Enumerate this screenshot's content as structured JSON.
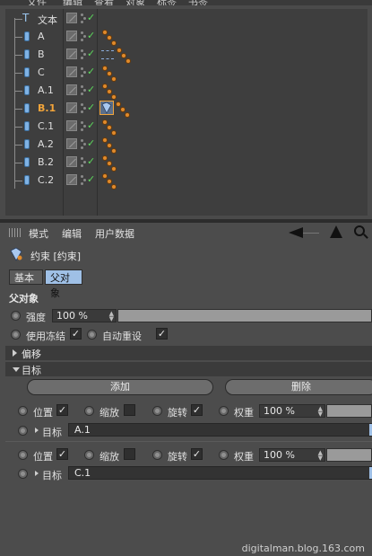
{
  "menubar": {
    "items": [
      "文件",
      "编辑",
      "查看",
      "对象",
      "标签",
      "书签"
    ]
  },
  "object_manager": {
    "rows": [
      {
        "name": "文本",
        "kind": "text",
        "selected": false,
        "tags": "none"
      },
      {
        "name": "A",
        "kind": "null",
        "selected": false,
        "tags": "dots"
      },
      {
        "name": "B",
        "kind": "null",
        "selected": false,
        "tags": "dots-target"
      },
      {
        "name": "C",
        "kind": "null",
        "selected": false,
        "tags": "dots"
      },
      {
        "name": "A.1",
        "kind": "null",
        "selected": false,
        "tags": "dots"
      },
      {
        "name": "B.1",
        "kind": "null",
        "selected": true,
        "tags": "constraint-selected"
      },
      {
        "name": "C.1",
        "kind": "null",
        "selected": false,
        "tags": "dots"
      },
      {
        "name": "A.2",
        "kind": "null",
        "selected": false,
        "tags": "dots"
      },
      {
        "name": "B.2",
        "kind": "null",
        "selected": false,
        "tags": "dots"
      },
      {
        "name": "C.2",
        "kind": "null",
        "selected": false,
        "tags": "dots"
      }
    ]
  },
  "attribute_manager": {
    "menu": {
      "mode": "模式",
      "edit": "编辑",
      "user_data": "用户数据"
    },
    "title": "约束 [约束]",
    "tabs": {
      "basic": "基本",
      "parent": "父对象"
    },
    "section_parent": "父对象",
    "strength": {
      "label": "强度",
      "value": "100 %",
      "level": 1.0
    },
    "use_freeze": {
      "label": "使用冻结",
      "checked": true
    },
    "auto_reset": {
      "label": "自动重设",
      "checked": true
    },
    "offset_header": "偏移",
    "targets_header": "目标",
    "add_button": "添加",
    "delete_button": "删除",
    "targets": [
      {
        "position": {
          "label": "位置",
          "checked": true
        },
        "scale": {
          "label": "缩放",
          "checked": false
        },
        "rotation": {
          "label": "旋转",
          "checked": true
        },
        "weight": {
          "label": "权重",
          "value": "100 %",
          "level": 1.0
        },
        "target_label": "目标",
        "target_value": "A.1"
      },
      {
        "position": {
          "label": "位置",
          "checked": true
        },
        "scale": {
          "label": "缩放",
          "checked": false
        },
        "rotation": {
          "label": "旋转",
          "checked": true
        },
        "weight": {
          "label": "权重",
          "value": "100 %",
          "level": 1.0
        },
        "target_label": "目标",
        "target_value": "C.1"
      }
    ]
  },
  "watermark": "digitalman.blog.163.com",
  "colors": {
    "selected_name": "#f2a43a",
    "tag_orange": "#e08a2c",
    "check_green": "#5ddc5d",
    "tab_active": "#9fc0e6"
  },
  "icons": {
    "text_object": "text-object-icon",
    "null_object": "null-object-icon",
    "constraint_tag": "constraint-tag-icon",
    "back": "back-arrow-icon",
    "up": "up-arrow-icon",
    "search": "search-icon"
  }
}
